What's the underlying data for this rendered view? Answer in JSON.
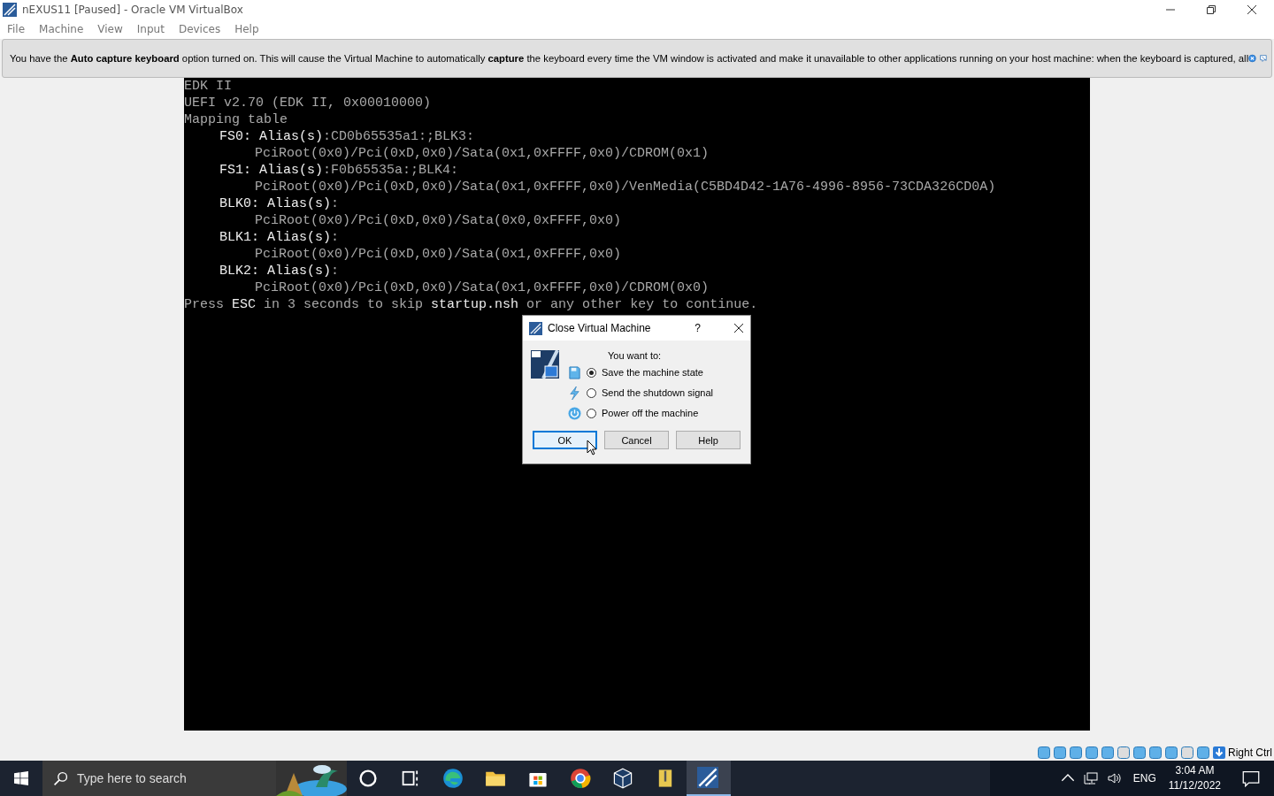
{
  "window": {
    "title": "nEXUS11 [Paused] - Oracle VM VirtualBox"
  },
  "menu": [
    "File",
    "Machine",
    "View",
    "Input",
    "Devices",
    "Help"
  ],
  "banner": {
    "text": "You have the **Auto capture keyboard** option turned on. This will cause the Virtual Machine to automatically **capture** the keyboard every time the VM window is activated and make it unavailable to other applications running on your host machine: when the keyboard is captured, all"
  },
  "terminal": [
    {
      "kind": "line",
      "text": "EDK II"
    },
    {
      "kind": "line",
      "text": "UEFI v2.70 (EDK II, 0x00010000)"
    },
    {
      "kind": "line",
      "text": "Mapping table"
    },
    {
      "kind": "entry",
      "label": "FS0: Alias(s)",
      "alias": ":CD0b65535a1:;BLK3:"
    },
    {
      "kind": "path",
      "text": "PciRoot(0x0)/Pci(0xD,0x0)/Sata(0x1,0xFFFF,0x0)/CDROM(0x1)"
    },
    {
      "kind": "entry",
      "label": "FS1: Alias(s)",
      "alias": ":F0b65535a:;BLK4:"
    },
    {
      "kind": "path",
      "text": "PciRoot(0x0)/Pci(0xD,0x0)/Sata(0x1,0xFFFF,0x0)/VenMedia(C5BD4D42-1A76-4996-8956-73CDA326CD0A)"
    },
    {
      "kind": "entry",
      "label": "BLK0: Alias(s)",
      "alias": ":"
    },
    {
      "kind": "path",
      "text": "PciRoot(0x0)/Pci(0xD,0x0)/Sata(0x0,0xFFFF,0x0)"
    },
    {
      "kind": "entry",
      "label": "BLK1: Alias(s)",
      "alias": ":"
    },
    {
      "kind": "path",
      "text": "PciRoot(0x0)/Pci(0xD,0x0)/Sata(0x1,0xFFFF,0x0)"
    },
    {
      "kind": "entry",
      "label": "BLK2: Alias(s)",
      "alias": ":"
    },
    {
      "kind": "path",
      "text": "PciRoot(0x0)/Pci(0xD,0x0)/Sata(0x1,0xFFFF,0x0)/CDROM(0x0)"
    },
    {
      "kind": "line",
      "text": "Press **ESC** in 3 seconds to skip **startup.nsh** or any other key to continue."
    }
  ],
  "dialog": {
    "title": "Close Virtual Machine",
    "help": "?",
    "prompt": "You want to:",
    "options": [
      {
        "kind": "save",
        "label": "Save the machine state",
        "selected": true
      },
      {
        "kind": "shutdown",
        "label": "Send the shutdown signal",
        "selected": false
      },
      {
        "kind": "power",
        "label": "Power off the machine",
        "selected": false
      }
    ],
    "buttons": [
      {
        "label": "OK",
        "selected": true
      },
      {
        "label": "Cancel",
        "selected": false
      },
      {
        "label": "Help",
        "selected": false
      }
    ]
  },
  "statusbar": {
    "host_key": "Right Ctrl"
  },
  "taskbar": {
    "search_placeholder": "Type here to search",
    "language": "ENG",
    "time": "3:04 AM",
    "date": "11/12/2022"
  }
}
